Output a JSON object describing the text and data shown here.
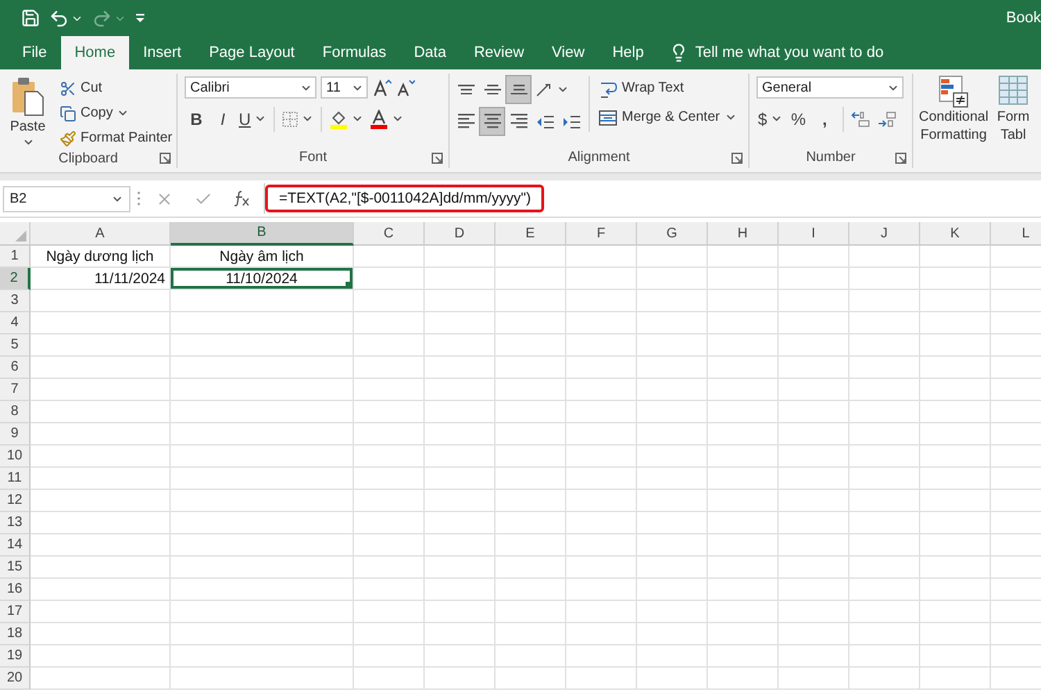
{
  "title_bar": {
    "title": "Book"
  },
  "quick_access": [
    {
      "kind": "save",
      "disabled": false
    },
    {
      "kind": "undo",
      "disabled": false
    },
    {
      "kind": "redo",
      "disabled": true
    },
    {
      "kind": "customize",
      "disabled": false
    }
  ],
  "tabs": [
    {
      "label": "File",
      "selected": false
    },
    {
      "label": "Home",
      "selected": true
    },
    {
      "label": "Insert",
      "selected": false
    },
    {
      "label": "Page Layout",
      "selected": false
    },
    {
      "label": "Formulas",
      "selected": false
    },
    {
      "label": "Data",
      "selected": false
    },
    {
      "label": "Review",
      "selected": false
    },
    {
      "label": "View",
      "selected": false
    },
    {
      "label": "Help",
      "selected": false
    }
  ],
  "tell_me": {
    "placeholder": "Tell me what you want to do"
  },
  "ribbon": {
    "clipboard": {
      "label": "Clipboard",
      "paste": "Paste",
      "cut": "Cut",
      "copy": "Copy",
      "format_painter": "Format Painter"
    },
    "font": {
      "label": "Font",
      "font_name": "Calibri",
      "font_size": "11",
      "bold": "B",
      "italic": "I",
      "underline": "U"
    },
    "alignment": {
      "label": "Alignment",
      "wrap_text": "Wrap Text",
      "merge_center": "Merge & Center",
      "vertical": [
        {
          "kind": "top",
          "selected": false
        },
        {
          "kind": "middle",
          "selected": false
        },
        {
          "kind": "bottom",
          "selected": true
        }
      ],
      "horizontal": [
        {
          "kind": "left",
          "selected": false
        },
        {
          "kind": "center",
          "selected": true
        },
        {
          "kind": "right",
          "selected": false
        }
      ]
    },
    "number": {
      "label": "Number",
      "format": "General",
      "currency": "$",
      "percent": "%",
      "comma": ","
    },
    "styles": {
      "conditional_formatting": [
        "Conditional",
        "Formatting"
      ],
      "format_as_table": [
        "Form",
        "Tabl"
      ]
    }
  },
  "formula_bar": {
    "name_box": "B2",
    "formula": "=TEXT(A2,\"[$-0011042A]dd/mm/yyyy\")",
    "highlighted": true
  },
  "columns": [
    {
      "label": "A",
      "selected": false
    },
    {
      "label": "B",
      "selected": true
    },
    {
      "label": "C",
      "selected": false
    },
    {
      "label": "D",
      "selected": false
    },
    {
      "label": "E",
      "selected": false
    },
    {
      "label": "F",
      "selected": false
    },
    {
      "label": "G",
      "selected": false
    },
    {
      "label": "H",
      "selected": false
    },
    {
      "label": "I",
      "selected": false
    },
    {
      "label": "J",
      "selected": false
    },
    {
      "label": "K",
      "selected": false
    },
    {
      "label": "L",
      "selected": false
    }
  ],
  "rows": [
    {
      "label": "1",
      "selected": false,
      "cells": [
        {
          "text": "Ngày dương lịch",
          "right_aligned": false,
          "active": false
        },
        {
          "text": "Ngày âm lịch",
          "right_aligned": false,
          "active": false
        }
      ]
    },
    {
      "label": "2",
      "selected": true,
      "cells": [
        {
          "text": "11/11/2024",
          "right_aligned": true,
          "active": false
        },
        {
          "text": "11/10/2024",
          "right_aligned": false,
          "active": true
        }
      ]
    },
    {
      "label": "3",
      "selected": false
    },
    {
      "label": "4",
      "selected": false
    },
    {
      "label": "5",
      "selected": false
    },
    {
      "label": "6",
      "selected": false
    },
    {
      "label": "7",
      "selected": false
    },
    {
      "label": "8",
      "selected": false
    },
    {
      "label": "9",
      "selected": false
    },
    {
      "label": "10",
      "selected": false
    },
    {
      "label": "11",
      "selected": false
    },
    {
      "label": "12",
      "selected": false
    },
    {
      "label": "13",
      "selected": false
    },
    {
      "label": "14",
      "selected": false
    },
    {
      "label": "15",
      "selected": false
    },
    {
      "label": "16",
      "selected": false
    },
    {
      "label": "17",
      "selected": false
    },
    {
      "label": "18",
      "selected": false
    },
    {
      "label": "19",
      "selected": false
    },
    {
      "label": "20",
      "selected": false
    }
  ]
}
